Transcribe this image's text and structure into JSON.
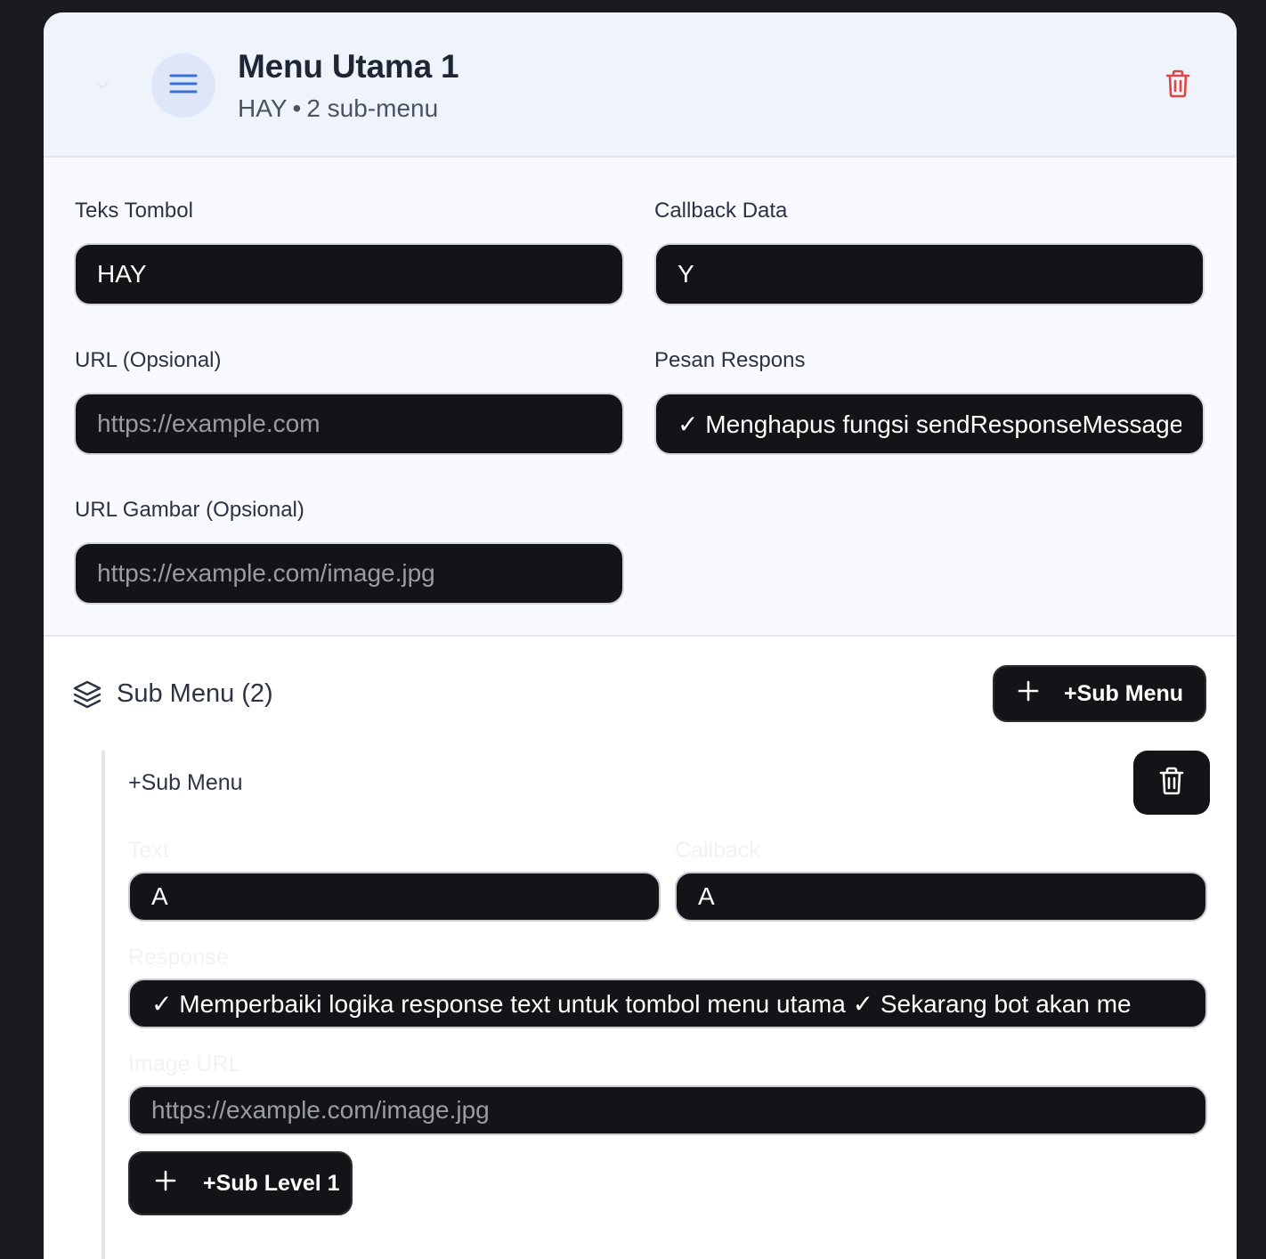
{
  "menu": {
    "title": "Menu Utama 1",
    "subtitle_name": "HAY",
    "subtitle_separator": "•",
    "subtitle_count": "2 sub-menu"
  },
  "form": {
    "button_text_label": "Teks Tombol",
    "button_text_value": "HAY",
    "callback_label": "Callback Data",
    "callback_value": "Y",
    "url_label": "URL (Opsional)",
    "url_placeholder": "https://example.com",
    "response_label": "Pesan Respons",
    "response_value": "✓ Menghapus fungsi sendResponseMessage",
    "image_url_label": "URL Gambar (Opsional)",
    "image_url_placeholder": "https://example.com/image.jpg"
  },
  "submenu": {
    "header_title": "Sub Menu (2)",
    "add_button_label": "+Sub Menu",
    "item": {
      "title": "+Sub Menu",
      "text_label": "Text",
      "text_value": "A",
      "callback_label": "Callback",
      "callback_value": "A",
      "response_label": "Response",
      "response_value": "✓ Memperbaiki logika response text untuk tombol menu utama ✓ Sekarang bot akan me",
      "image_url_label": "Image URL",
      "image_url_placeholder": "https://example.com/image.jpg",
      "add_level_label": "+Sub Level 1"
    }
  },
  "icons": {
    "collapse": "chevron-down-icon",
    "menu": "menu-lines-icon",
    "delete": "trash-icon",
    "layers": "layers-icon",
    "add": "plus-icon"
  },
  "colors": {
    "accent_blue": "#3b6fd8",
    "danger_red": "#e04545",
    "input_bg": "#141418",
    "header_bg": "#eef3fc"
  }
}
